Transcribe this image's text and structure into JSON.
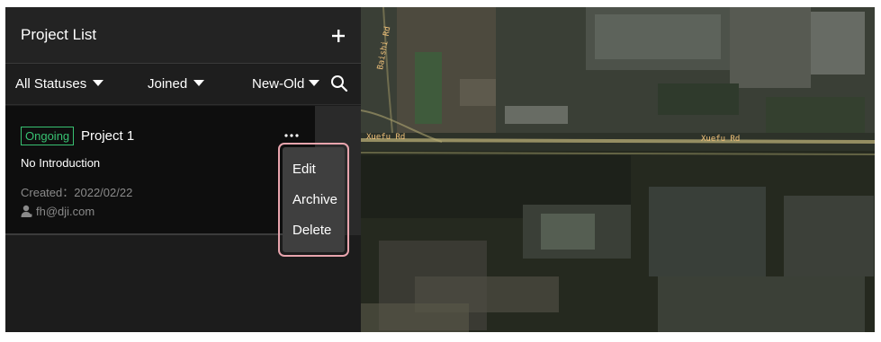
{
  "panel": {
    "title": "Project List",
    "add_icon": "plus-icon"
  },
  "filters": {
    "status": "All Statuses",
    "membership": "Joined",
    "sort": "New-Old",
    "search_icon": "search-icon"
  },
  "project": {
    "status": "Ongoing",
    "status_color": "#38c172",
    "name": "Project 1",
    "introduction": "No Introduction",
    "created": "Created：2022/02/22",
    "owner": "fh@dji.com",
    "owner_icon": "user-icon",
    "more_icon": "more-icon"
  },
  "menu": {
    "items": [
      "Edit",
      "Archive",
      "Delete"
    ],
    "highlight_color": "#e8a4ad"
  },
  "map": {
    "roads": [
      "Baishi Rd",
      "Xuefu Rd",
      "Xuefu Rd"
    ]
  }
}
